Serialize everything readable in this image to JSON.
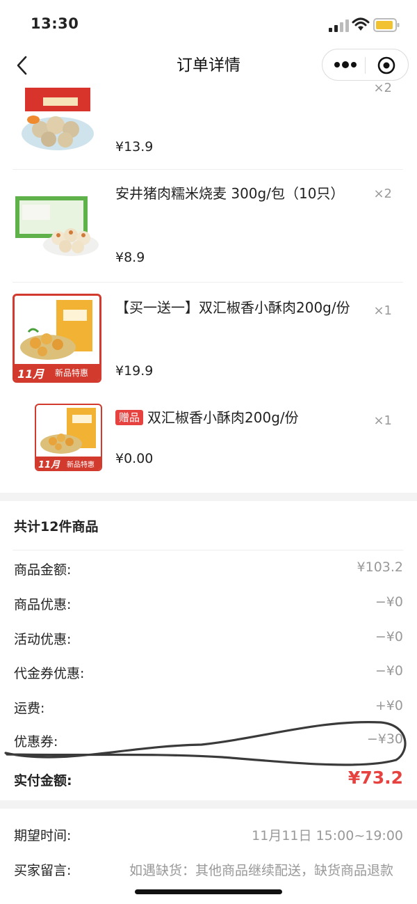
{
  "status_bar": {
    "time": "13:30"
  },
  "nav": {
    "title": "订单详情"
  },
  "products": [
    {
      "name": "",
      "qty": "×2",
      "price": "¥13.9"
    },
    {
      "name": "安井猪肉糯米烧麦 300g/包（10只）",
      "qty": "×2",
      "price": "¥8.9"
    },
    {
      "name": "【买一送一】双汇椒香小酥肉200g/份",
      "qty": "×1",
      "price": "¥19.9",
      "badge_month": "11月",
      "badge_text": "新品特惠"
    },
    {
      "gift_tag": "赠品",
      "name": "双汇椒香小酥肉200g/份",
      "qty": "×1",
      "price": "¥0.00",
      "badge_month": "11月",
      "badge_text": "新品特惠"
    }
  ],
  "summary": {
    "title": "共计12件商品",
    "rows": [
      {
        "label": "商品金额:",
        "value": "¥103.2"
      },
      {
        "label": "商品优惠:",
        "value": "−¥0"
      },
      {
        "label": "活动优惠:",
        "value": "−¥0"
      },
      {
        "label": "代金券优惠:",
        "value": "−¥0"
      },
      {
        "label": "运费:",
        "value": "+¥0"
      },
      {
        "label": "优惠券:",
        "value": "−¥30"
      }
    ],
    "total_label": "实付金额:",
    "total_value": "¥73.2"
  },
  "delivery": {
    "time_label": "期望时间:",
    "time_value": "11月11日 15:00~19:00",
    "note_label": "买家留言:",
    "note_value": "如遇缺货：其他商品继续配送，缺货商品退款"
  },
  "colors": {
    "accent_red": "#e64340",
    "muted_text": "#999999",
    "section_gap": "#f3f3f3"
  }
}
